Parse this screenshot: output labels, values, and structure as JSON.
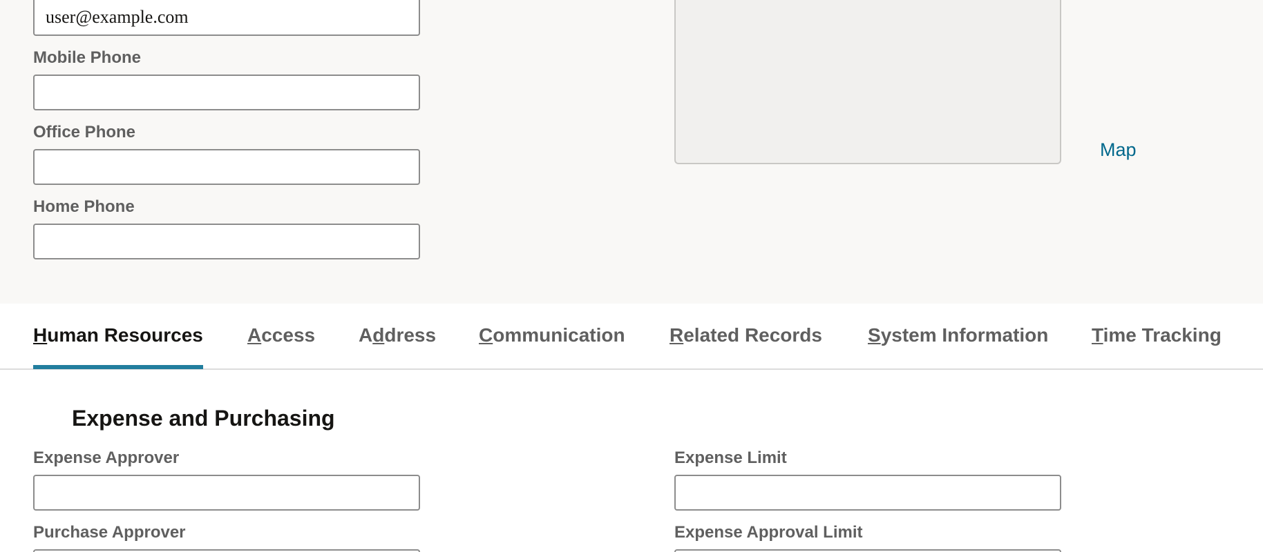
{
  "contact": {
    "email_value": "user@example.com",
    "mobile_phone_label": "Mobile Phone",
    "office_phone_label": "Office Phone",
    "home_phone_label": "Home Phone",
    "map_link": "Map"
  },
  "tabs": [
    {
      "mnemonic": "H",
      "rest": "uman Resources"
    },
    {
      "mnemonic": "A",
      "rest": "ccess"
    },
    {
      "before": "A",
      "mnemonic": "d",
      "rest": "dress"
    },
    {
      "mnemonic": "C",
      "rest": "ommunication"
    },
    {
      "mnemonic": "R",
      "rest": "elated Records"
    },
    {
      "mnemonic": "S",
      "rest": "ystem Information"
    },
    {
      "mnemonic": "T",
      "rest": "ime Tracking"
    }
  ],
  "expense_section": {
    "title": "Expense and Purchasing",
    "expense_approver_label": "Expense Approver",
    "purchase_approver_label": "Purchase Approver",
    "expense_limit_label": "Expense Limit",
    "expense_approval_limit_label": "Expense Approval Limit"
  },
  "colors": {
    "accent": "#227e9e",
    "link": "#00688c",
    "top_background": "#f9f8f6"
  }
}
